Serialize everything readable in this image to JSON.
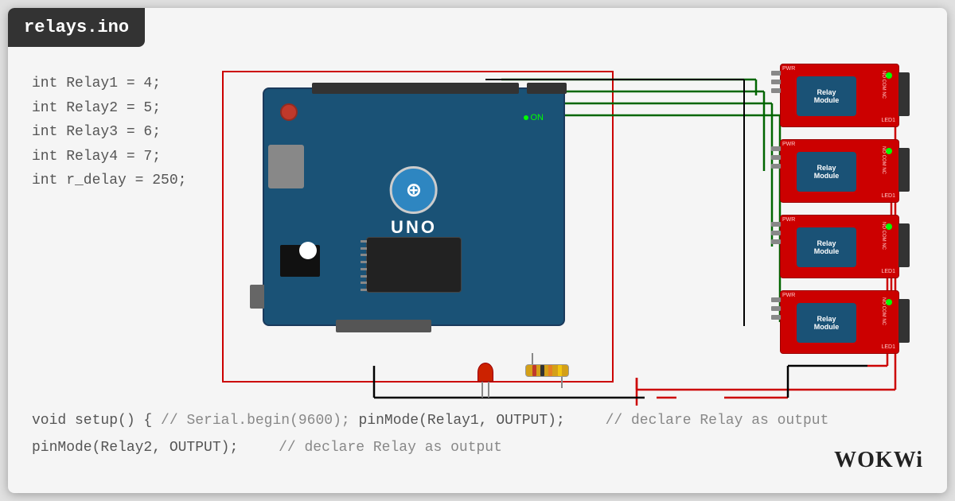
{
  "title": "relays.ino",
  "code": {
    "line1": "int Relay1  = 4;",
    "line2": "int Relay2  = 5;",
    "line3": "int Relay3  = 6;",
    "line4": "int Relay4  = 7;",
    "line5": "int r_delay = 250;",
    "line6": "",
    "line7": "void setup() {",
    "line8": "//  Serial.begin(9600);",
    "line9": "  pinMode(Relay1, OUTPUT);",
    "line9_comment": "// declare Relay as output",
    "line10": "  pinMode(Relay2, OUTPUT);",
    "line10_comment": "// declare Relay as output"
  },
  "brand": "WOKWi",
  "arduino": {
    "model": "UNO",
    "brand": "ARDUINO",
    "status": "ON"
  },
  "relays": [
    {
      "label": "Relay Module",
      "id": 1
    },
    {
      "label": "Relay Module",
      "id": 2
    },
    {
      "label": "Relay Module",
      "id": 3
    },
    {
      "label": "Relay Module",
      "id": 4
    }
  ]
}
